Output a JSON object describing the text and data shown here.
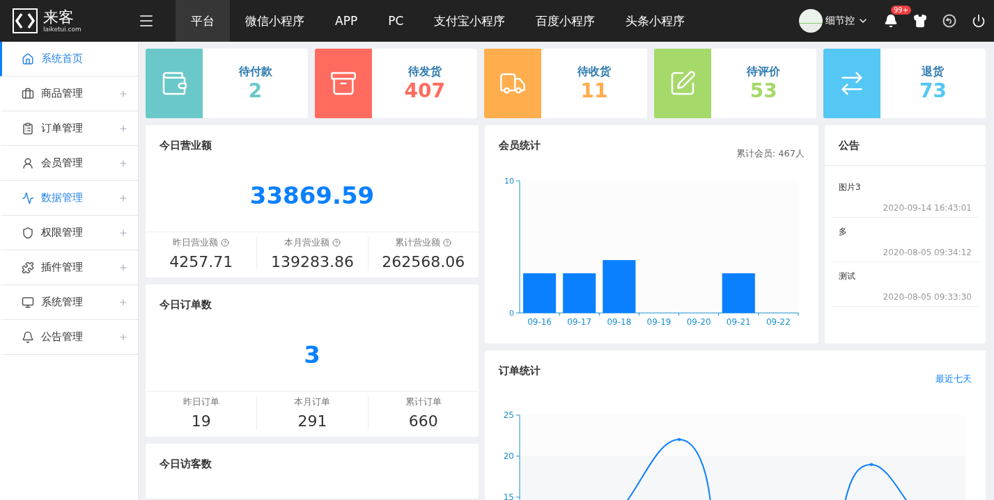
{
  "logo": {
    "name": "来客",
    "domain": "laiketui.com"
  },
  "nav_tabs": [
    {
      "label": "平台",
      "selected": true
    },
    {
      "label": "微信小程序",
      "selected": false
    },
    {
      "label": "APP",
      "selected": false
    },
    {
      "label": "PC",
      "selected": false
    },
    {
      "label": "支付宝小程序",
      "selected": false
    },
    {
      "label": "百度小程序",
      "selected": false
    },
    {
      "label": "头条小程序",
      "selected": false
    }
  ],
  "user": {
    "name": "细节控",
    "notification_badge": "99+"
  },
  "sidebar": {
    "items": [
      {
        "label": "系统首页",
        "selected": true,
        "highlighted": false,
        "expandable": false
      },
      {
        "label": "商品管理",
        "selected": false,
        "highlighted": false,
        "expandable": true
      },
      {
        "label": "订单管理",
        "selected": false,
        "highlighted": false,
        "expandable": true
      },
      {
        "label": "会员管理",
        "selected": false,
        "highlighted": false,
        "expandable": true
      },
      {
        "label": "数据管理",
        "selected": false,
        "highlighted": true,
        "expandable": true
      },
      {
        "label": "权限管理",
        "selected": false,
        "highlighted": false,
        "expandable": true
      },
      {
        "label": "插件管理",
        "selected": false,
        "highlighted": false,
        "expandable": true
      },
      {
        "label": "系统管理",
        "selected": false,
        "highlighted": false,
        "expandable": true
      },
      {
        "label": "公告管理",
        "selected": false,
        "highlighted": false,
        "expandable": true
      }
    ]
  },
  "stat_cards": [
    {
      "label": "待付款",
      "value": "2",
      "color": "#6bc8c8"
    },
    {
      "label": "待发货",
      "value": "407",
      "color": "#ff6c5f"
    },
    {
      "label": "待收货",
      "value": "11",
      "color": "#ffad4d"
    },
    {
      "label": "待评价",
      "value": "53",
      "color": "#a5d96a"
    },
    {
      "label": "退货",
      "value": "73",
      "color": "#55c7f5"
    }
  ],
  "summary_cards": [
    {
      "title": "今日营业额",
      "value": "33869.59",
      "columns": [
        {
          "label": "昨日营业额",
          "value": "4257.71",
          "help": true
        },
        {
          "label": "本月营业额",
          "value": "139283.86",
          "help": true
        },
        {
          "label": "累计营业额",
          "value": "262568.06",
          "help": true
        }
      ]
    },
    {
      "title": "今日订单数",
      "value": "3",
      "columns": [
        {
          "label": "昨日订单",
          "value": "19",
          "help": false
        },
        {
          "label": "本月订单",
          "value": "291",
          "help": false
        },
        {
          "label": "累计订单",
          "value": "660",
          "help": false
        }
      ]
    },
    {
      "title": "今日访客数"
    }
  ],
  "member_stats": {
    "title": "会员统计",
    "total": "累计会员: 467人",
    "chart_data": {
      "type": "bar",
      "categories": [
        "09-16",
        "09-17",
        "09-18",
        "09-19",
        "09-20",
        "09-21",
        "09-22"
      ],
      "series": [
        {
          "color": "#0a80ff",
          "values": [
            3,
            3,
            4,
            0,
            0,
            3,
            0
          ]
        }
      ],
      "ylim": [
        0,
        10
      ],
      "yticks": [
        0,
        10
      ]
    }
  },
  "notices": {
    "title": "公告",
    "items": [
      {
        "title": "图片3",
        "time": "2020-09-14 16:43:01"
      },
      {
        "title": "多",
        "time": "2020-08-05 09:34:12"
      },
      {
        "title": "测试",
        "time": "2020-08-05 09:33:30"
      }
    ]
  },
  "order_stats": {
    "title": "订单统计",
    "range_link": "最近七天",
    "y_ticks": [
      "25",
      "20",
      "15"
    ]
  }
}
